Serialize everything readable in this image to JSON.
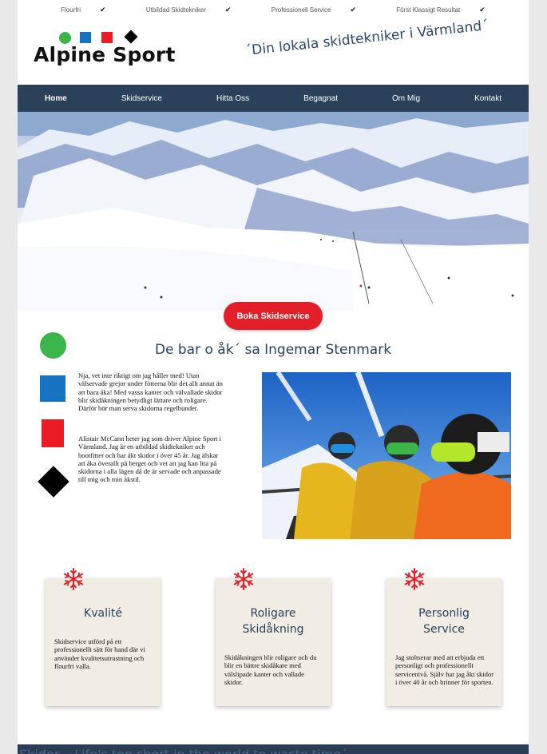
{
  "topbar": {
    "items": [
      "Flourfri",
      "Utbildad Skidtekniker",
      "Professionell Service",
      "Först Klassigt Resultat"
    ],
    "check": "✔"
  },
  "logo": {
    "text": "Alpine Sport"
  },
  "slogan": "´Din lokala skidtekniker i Värmland´",
  "nav": {
    "items": [
      "Home",
      "Skidservice",
      "Hitta Oss",
      "Begagnat",
      "Om Mig",
      "Kontakt"
    ]
  },
  "cta": {
    "label": "Boka Skidservice"
  },
  "intro": {
    "heading": "De bar o åk´ sa Ingemar Stenmark",
    "p1": "Nja, vet inte riktigt om jag håller med! Utan välservade grejor under fötterna blir det allt annat än att bara åka! Med vassa kanter och välvallade skidor blir skidåkningen betydligt lättare och roligare. Därför bör man serva skidorna regelbundet.",
    "p2": "Alistair McCann heter jag som driver Alpine Sport i Värmland. Jag är en utbildad skidtekniker och bootfitter och har åkt skidor i över 45 år. Jag älskar att åka överallt på berget och vet att jag kan lita på skidorna i alla lägen då de är servade och anpassade till mig och min åkstil."
  },
  "cards": [
    {
      "title": "Kvalité",
      "desc": "Skidservice utförd på ett professionellt sätt för hand där vi använder kvalitetsutrustning och flourfri valla."
    },
    {
      "title": "Roligare Skidåkning",
      "desc": "Skidåkningen blir roligare och du blir en bättre skidåkare med välslipade kanter och vallade skidor."
    },
    {
      "title": "Personlig Service",
      "desc": "Jag stoltserar med att erbjuda ett personligt och professionellt servicenivå. Själv har jag åkt skidor i över 40 år och brinner för sporten."
    }
  ],
  "bottom_banner": "Skidor... Life's too short in the world to waste time´",
  "colors": {
    "nav_bg": "#2a4159",
    "cta": "#e3202a",
    "green": "#3bb54a",
    "blue": "#1673c2",
    "red": "#ed1c24",
    "black": "#000000",
    "card_bg": "#f1ede4",
    "heading": "#2b4159"
  }
}
